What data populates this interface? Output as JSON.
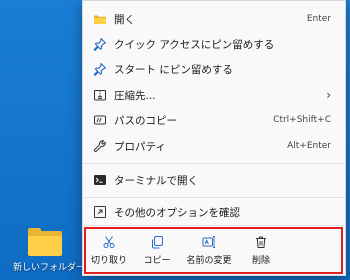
{
  "desktop": {
    "folder_label": "新しいフォルダー",
    "background_color": "#1072c9"
  },
  "menu": {
    "items": [
      {
        "label": "開く",
        "shortcut": "Enter",
        "icon": "folder-open-icon"
      },
      {
        "label": "クイック アクセスにピン留めする",
        "shortcut": "",
        "icon": "pin-icon"
      },
      {
        "label": "スタート にピン留めする",
        "shortcut": "",
        "icon": "pin-icon"
      },
      {
        "label": "圧縮先...",
        "shortcut": "",
        "icon": "archive-icon",
        "submenu": true
      },
      {
        "label": "パスのコピー",
        "shortcut": "Ctrl+Shift+C",
        "icon": "copy-path-icon"
      },
      {
        "label": "プロパティ",
        "shortcut": "Alt+Enter",
        "icon": "wrench-icon"
      },
      {
        "label": "ターミナルで開く",
        "shortcut": "",
        "icon": "terminal-icon"
      },
      {
        "label": "その他のオプションを確認",
        "shortcut": "",
        "icon": "more-options-icon"
      }
    ],
    "submenu_arrow": "›",
    "bottom_actions": [
      {
        "label": "切り取り",
        "icon": "scissors-icon"
      },
      {
        "label": "コピー",
        "icon": "copy-icon"
      },
      {
        "label": "名前の変更",
        "icon": "rename-icon"
      },
      {
        "label": "削除",
        "icon": "trash-icon"
      }
    ]
  },
  "colors": {
    "accent": "#0067c0",
    "highlight_border": "#e0201e",
    "folder": "#ffcf48"
  }
}
